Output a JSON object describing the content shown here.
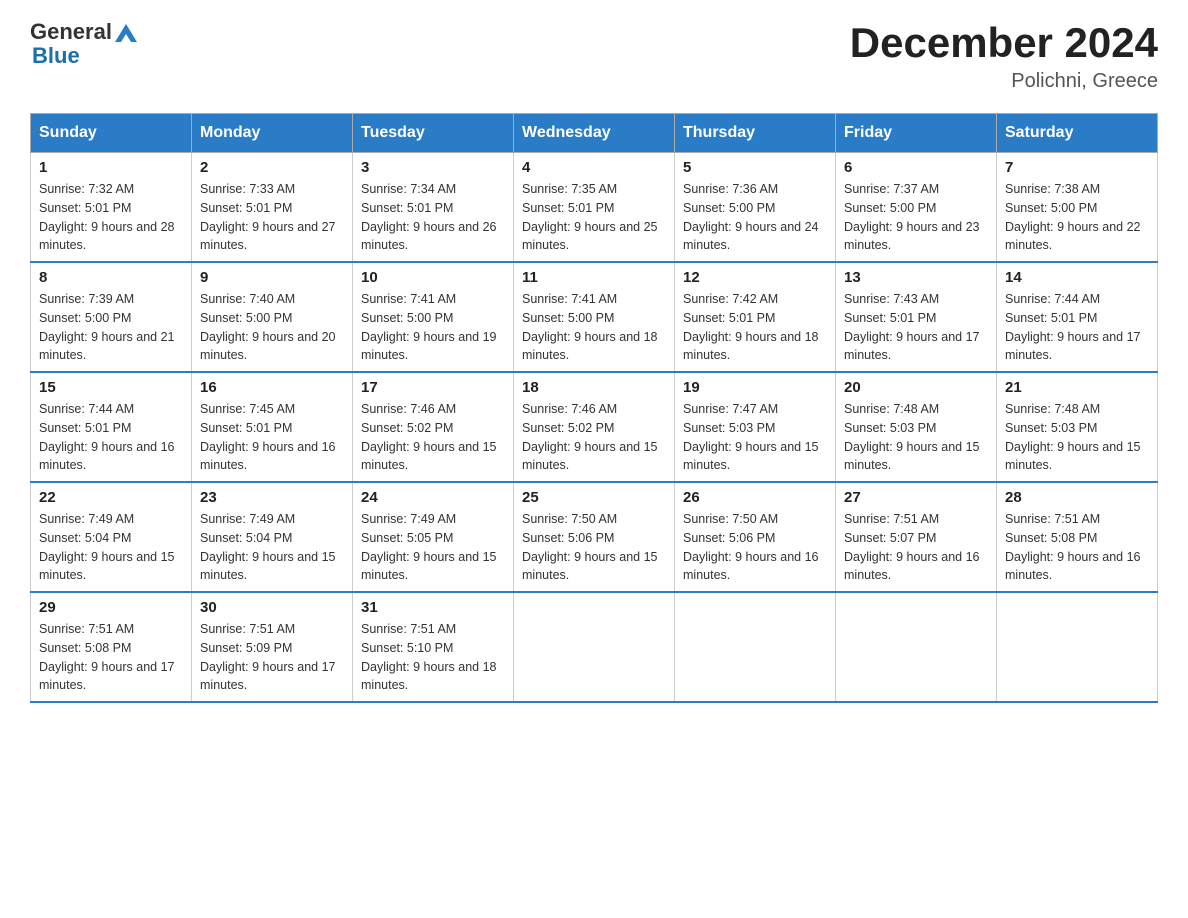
{
  "header": {
    "logo_general": "General",
    "logo_blue": "Blue",
    "title": "December 2024",
    "subtitle": "Polichni, Greece"
  },
  "days_of_week": [
    "Sunday",
    "Monday",
    "Tuesday",
    "Wednesday",
    "Thursday",
    "Friday",
    "Saturday"
  ],
  "weeks": [
    [
      {
        "day": "1",
        "sunrise": "7:32 AM",
        "sunset": "5:01 PM",
        "daylight": "9 hours and 28 minutes."
      },
      {
        "day": "2",
        "sunrise": "7:33 AM",
        "sunset": "5:01 PM",
        "daylight": "9 hours and 27 minutes."
      },
      {
        "day": "3",
        "sunrise": "7:34 AM",
        "sunset": "5:01 PM",
        "daylight": "9 hours and 26 minutes."
      },
      {
        "day": "4",
        "sunrise": "7:35 AM",
        "sunset": "5:01 PM",
        "daylight": "9 hours and 25 minutes."
      },
      {
        "day": "5",
        "sunrise": "7:36 AM",
        "sunset": "5:00 PM",
        "daylight": "9 hours and 24 minutes."
      },
      {
        "day": "6",
        "sunrise": "7:37 AM",
        "sunset": "5:00 PM",
        "daylight": "9 hours and 23 minutes."
      },
      {
        "day": "7",
        "sunrise": "7:38 AM",
        "sunset": "5:00 PM",
        "daylight": "9 hours and 22 minutes."
      }
    ],
    [
      {
        "day": "8",
        "sunrise": "7:39 AM",
        "sunset": "5:00 PM",
        "daylight": "9 hours and 21 minutes."
      },
      {
        "day": "9",
        "sunrise": "7:40 AM",
        "sunset": "5:00 PM",
        "daylight": "9 hours and 20 minutes."
      },
      {
        "day": "10",
        "sunrise": "7:41 AM",
        "sunset": "5:00 PM",
        "daylight": "9 hours and 19 minutes."
      },
      {
        "day": "11",
        "sunrise": "7:41 AM",
        "sunset": "5:00 PM",
        "daylight": "9 hours and 18 minutes."
      },
      {
        "day": "12",
        "sunrise": "7:42 AM",
        "sunset": "5:01 PM",
        "daylight": "9 hours and 18 minutes."
      },
      {
        "day": "13",
        "sunrise": "7:43 AM",
        "sunset": "5:01 PM",
        "daylight": "9 hours and 17 minutes."
      },
      {
        "day": "14",
        "sunrise": "7:44 AM",
        "sunset": "5:01 PM",
        "daylight": "9 hours and 17 minutes."
      }
    ],
    [
      {
        "day": "15",
        "sunrise": "7:44 AM",
        "sunset": "5:01 PM",
        "daylight": "9 hours and 16 minutes."
      },
      {
        "day": "16",
        "sunrise": "7:45 AM",
        "sunset": "5:01 PM",
        "daylight": "9 hours and 16 minutes."
      },
      {
        "day": "17",
        "sunrise": "7:46 AM",
        "sunset": "5:02 PM",
        "daylight": "9 hours and 15 minutes."
      },
      {
        "day": "18",
        "sunrise": "7:46 AM",
        "sunset": "5:02 PM",
        "daylight": "9 hours and 15 minutes."
      },
      {
        "day": "19",
        "sunrise": "7:47 AM",
        "sunset": "5:03 PM",
        "daylight": "9 hours and 15 minutes."
      },
      {
        "day": "20",
        "sunrise": "7:48 AM",
        "sunset": "5:03 PM",
        "daylight": "9 hours and 15 minutes."
      },
      {
        "day": "21",
        "sunrise": "7:48 AM",
        "sunset": "5:03 PM",
        "daylight": "9 hours and 15 minutes."
      }
    ],
    [
      {
        "day": "22",
        "sunrise": "7:49 AM",
        "sunset": "5:04 PM",
        "daylight": "9 hours and 15 minutes."
      },
      {
        "day": "23",
        "sunrise": "7:49 AM",
        "sunset": "5:04 PM",
        "daylight": "9 hours and 15 minutes."
      },
      {
        "day": "24",
        "sunrise": "7:49 AM",
        "sunset": "5:05 PM",
        "daylight": "9 hours and 15 minutes."
      },
      {
        "day": "25",
        "sunrise": "7:50 AM",
        "sunset": "5:06 PM",
        "daylight": "9 hours and 15 minutes."
      },
      {
        "day": "26",
        "sunrise": "7:50 AM",
        "sunset": "5:06 PM",
        "daylight": "9 hours and 16 minutes."
      },
      {
        "day": "27",
        "sunrise": "7:51 AM",
        "sunset": "5:07 PM",
        "daylight": "9 hours and 16 minutes."
      },
      {
        "day": "28",
        "sunrise": "7:51 AM",
        "sunset": "5:08 PM",
        "daylight": "9 hours and 16 minutes."
      }
    ],
    [
      {
        "day": "29",
        "sunrise": "7:51 AM",
        "sunset": "5:08 PM",
        "daylight": "9 hours and 17 minutes."
      },
      {
        "day": "30",
        "sunrise": "7:51 AM",
        "sunset": "5:09 PM",
        "daylight": "9 hours and 17 minutes."
      },
      {
        "day": "31",
        "sunrise": "7:51 AM",
        "sunset": "5:10 PM",
        "daylight": "9 hours and 18 minutes."
      },
      null,
      null,
      null,
      null
    ]
  ]
}
